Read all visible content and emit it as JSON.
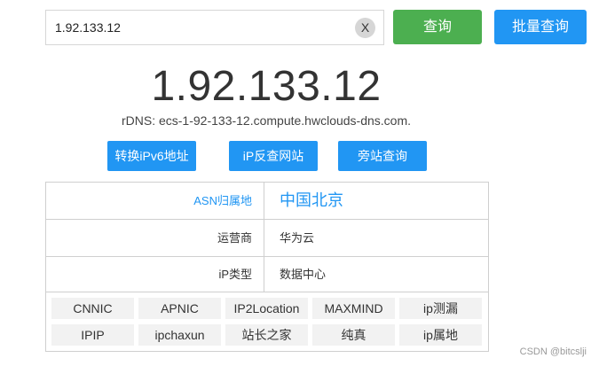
{
  "search": {
    "value": "1.92.133.12",
    "clear_label": "X",
    "query_label": "查询",
    "batch_label": "批量查询"
  },
  "result": {
    "ip": "1.92.133.12",
    "rdns": "rDNS: ecs-1-92-133-12.compute.hwclouds-dns.com."
  },
  "actions": {
    "ipv6_label": "转换iPv6地址",
    "reverse_label": "iP反查网站",
    "sideway_label": "旁站查询"
  },
  "info": {
    "asn": {
      "label": "ASN归属地",
      "value": "中国北京"
    },
    "isp": {
      "label": "运营商",
      "value": "华为云"
    },
    "type": {
      "label": "iP类型",
      "value": "数据中心"
    }
  },
  "sources": [
    "CNNIC",
    "APNIC",
    "IP2Location",
    "MAXMIND",
    "ip测漏",
    "IPIP",
    "ipchaxun",
    "站长之家",
    "纯真",
    "ip属地"
  ],
  "watermark": "CSDN @bitcslji",
  "colors": {
    "query_green": "#4caf50",
    "primary_blue": "#2196f3"
  }
}
